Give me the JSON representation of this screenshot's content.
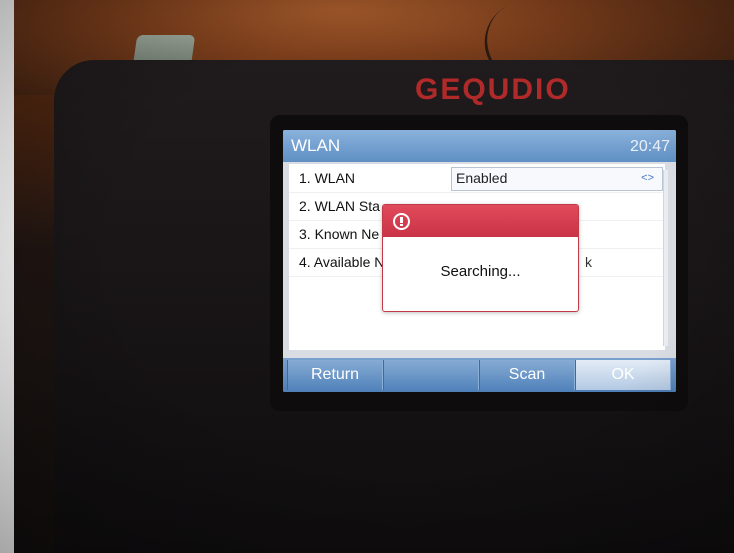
{
  "device": {
    "brand": "GEQUDIO"
  },
  "screen": {
    "title": "WLAN",
    "time": "20:47",
    "rows": [
      {
        "label": "1. WLAN",
        "value": "Enabled",
        "value_icon": "left-right-arrows-icon"
      },
      {
        "label": "2. WLAN Sta"
      },
      {
        "label": "3. Known Ne"
      },
      {
        "label": "4. Available N",
        "extra": "k"
      }
    ],
    "dialog": {
      "icon": "alert-circle-icon",
      "message": "Searching..."
    },
    "softkeys": [
      {
        "label": "Return"
      },
      {
        "label": ""
      },
      {
        "label": "Scan"
      },
      {
        "label": "OK"
      }
    ]
  },
  "colors": {
    "titlebar": "#6f9ed2",
    "dialog_header": "#d63d50",
    "brand": "#b02a2a",
    "softkey": "#5f8fc4"
  }
}
